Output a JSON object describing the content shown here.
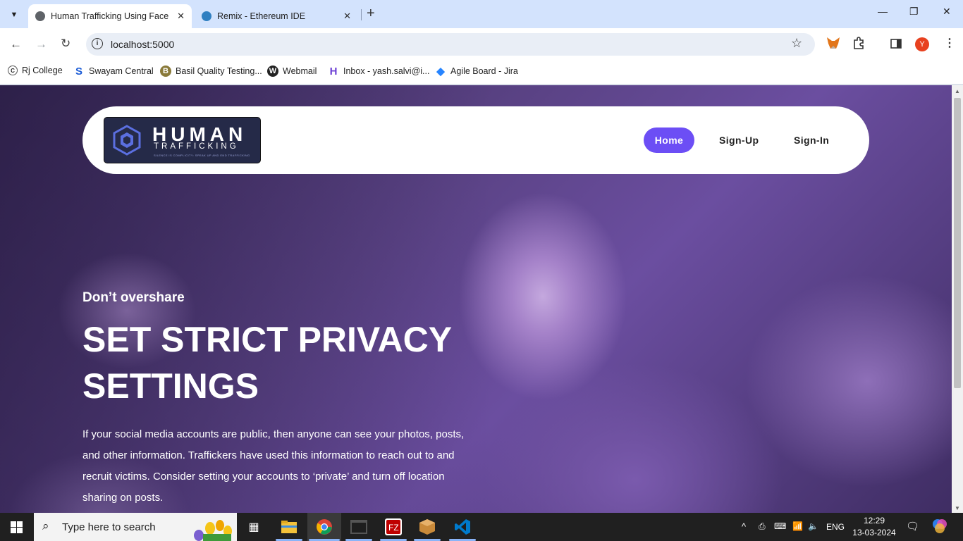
{
  "browser": {
    "tabs": [
      {
        "title": "Human Trafficking Using Face R",
        "active": true
      },
      {
        "title": "Remix - Ethereum IDE",
        "active": false
      }
    ],
    "url": "localhost:5000",
    "profile_initial": "Y",
    "bookmarks": [
      {
        "label": "Rj College",
        "icon": "college-icon"
      },
      {
        "label": "Swayam Central",
        "icon": "swayam-icon"
      },
      {
        "label": "Basil Quality Testing...",
        "icon": "basil-icon"
      },
      {
        "label": "Webmail",
        "icon": "webmail-icon"
      },
      {
        "label": "Inbox - yash.salvi@i...",
        "icon": "inbox-icon"
      },
      {
        "label": "Agile Board - Jira",
        "icon": "jira-icon"
      }
    ]
  },
  "site": {
    "logo": {
      "line1": "HUMAN",
      "line2": "TRAFFICKING",
      "tagline": "SILENCE IS COMPLICITY: SPEAK UP AND END TRAFFICKING"
    },
    "nav": {
      "home": "Home",
      "signup": "Sign-Up",
      "signin": "Sign-In"
    },
    "hero": {
      "kicker": "Don’t overshare",
      "headline": "SET STRICT PRIVACY SETTINGS",
      "body": "If your social media accounts are public, then anyone can see your photos, posts, and other information. Traffickers have used this information to reach out to and recruit victims. Consider setting your accounts to ‘private’ and turn off location sharing on posts."
    },
    "accent_color": "#6c4ef5"
  },
  "taskbar": {
    "search_placeholder": "Type here to search",
    "language": "ENG",
    "time": "12:29",
    "date": "13-03-2024"
  }
}
